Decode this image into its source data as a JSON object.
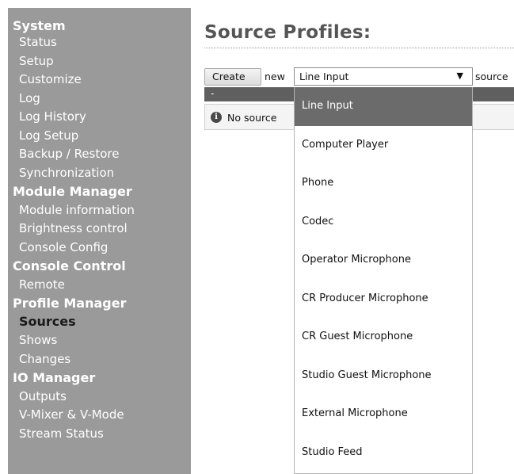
{
  "sidebar": {
    "system": {
      "title": "System",
      "items": [
        "Status",
        "Setup",
        "Customize",
        "Log",
        "Log History",
        "Log Setup",
        "Backup / Restore",
        "Synchronization"
      ]
    },
    "module_manager": {
      "title": "Module Manager",
      "items": [
        "Module information",
        "Brightness control",
        "Console Config"
      ]
    },
    "console_control": {
      "title": "Console Control",
      "items": [
        "Remote"
      ]
    },
    "profile_manager": {
      "title": "Profile Manager",
      "items": [
        "Sources",
        "Shows",
        "Changes"
      ],
      "active": "Sources"
    },
    "io_manager": {
      "title": "IO Manager",
      "items": [
        "Outputs",
        "V-Mixer & V-Mode",
        "Stream Status"
      ]
    }
  },
  "main": {
    "title": "Source Profiles:",
    "create_label": "Create",
    "new_label": "new",
    "select_value": "Line Input",
    "select_arrow": "▼",
    "source_label": "source",
    "table_header": "-",
    "info_glyph": "i",
    "empty_text": "No source"
  },
  "dropdown": {
    "selected": "Line Input",
    "options": [
      "Line Input",
      "Computer Player",
      "Phone",
      "Codec",
      "Operator Microphone",
      "CR Producer Microphone",
      "CR Guest Microphone",
      "Studio Guest Microphone",
      "External Microphone",
      "Studio Feed"
    ]
  },
  "colors": {
    "sidebar_bg": "#9a9a9a",
    "selected_option_bg": "#6b6b6b",
    "table_header_bg": "#5f5f5f"
  }
}
